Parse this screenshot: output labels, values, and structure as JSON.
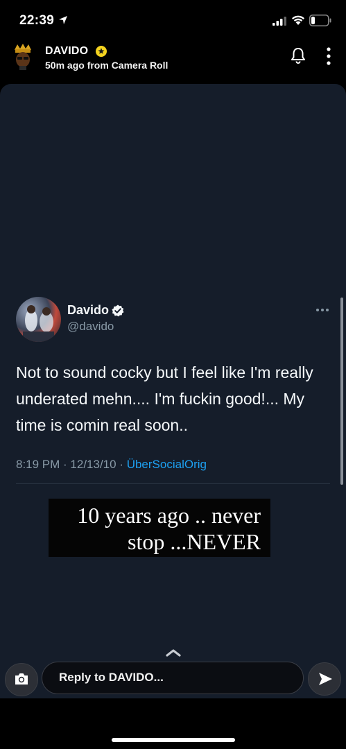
{
  "status_bar": {
    "time": "22:39",
    "location_icon": "location-arrow-icon",
    "signal_icon": "cellular-signal-icon",
    "wifi_icon": "wifi-icon",
    "battery_icon": "battery-icon",
    "battery_level_fraction": 0.2
  },
  "story_header": {
    "avatar_icon": "bitmoji-avatar-icon",
    "user_name": "DAVIDO",
    "badge_icon": "star-badge-icon",
    "badge_color": "#f4d31f",
    "meta": "50m ago from Camera Roll",
    "bell_icon": "bell-icon",
    "more_icon": "more-vertical-icon"
  },
  "tweet": {
    "display_name": "Davido",
    "verified_icon": "verified-badge-icon",
    "handle": "@davido",
    "more_icon": "more-horizontal-icon",
    "text": "Not to sound cocky but I feel like I'm really underated mehn.... I'm fuckin good!... My time is comin real soon..",
    "timestamp": "8:19 PM · 12/13/10 · ",
    "source": "ÜberSocialOrig",
    "link_color": "#1da1f2"
  },
  "caption": {
    "line1": "10 years ago .. never",
    "line2": "stop ...NEVER"
  },
  "swipe_up_icon": "chevron-up-icon",
  "reply_bar": {
    "camera_icon": "camera-icon",
    "placeholder": "Reply to DAVIDO...",
    "send_icon": "send-arrow-icon"
  },
  "colors": {
    "canvas_background": "#151d2a",
    "page_background": "#000000",
    "secondary_text": "#8899a6"
  }
}
